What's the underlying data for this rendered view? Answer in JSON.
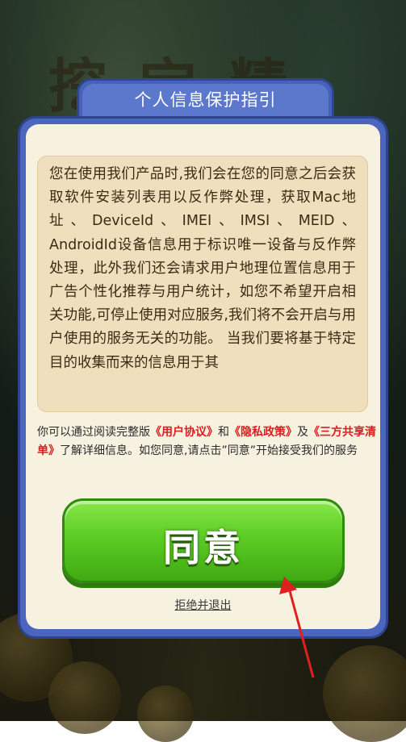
{
  "dialog": {
    "title": "个人信息保护指引",
    "body": "您在使用我们产品时,我们会在您的同意之后会获取软件安装列表用以反作弊处理，获取Mac地址、DeviceId、IMEI、IMSI、MEID、AndroidId设备信息用于标识唯一设备与反作弊处理，此外我们还会请求用户地理位置信息用于广告个性化推荐与用户统计，如您不希望开启相关功能,可停止使用对应服务,我们将不会开启与用户使用的服务无关的功能。 当我们要将基于特定目的收集而来的信息用于其",
    "notice_prefix": "你可以通过阅读完整版",
    "link_user_agreement": "《用户协议》",
    "notice_and": "和",
    "link_privacy_policy": "《隐私政策》",
    "notice_and2": "及",
    "link_third_party_list": "《三方共享清单》",
    "notice_suffix": "了解详细信息。如您同意,请点击”同意”开始接受我们的服务",
    "agree_label": "同意",
    "reject_label": "拒绝并退出"
  },
  "colors": {
    "frame": "#4c66bf",
    "panel": "#f7f1e0",
    "text_box": "#f0dfbd",
    "link": "#d62020",
    "agree_button": "#5ccc24",
    "annotation_arrow": "#e02020"
  }
}
